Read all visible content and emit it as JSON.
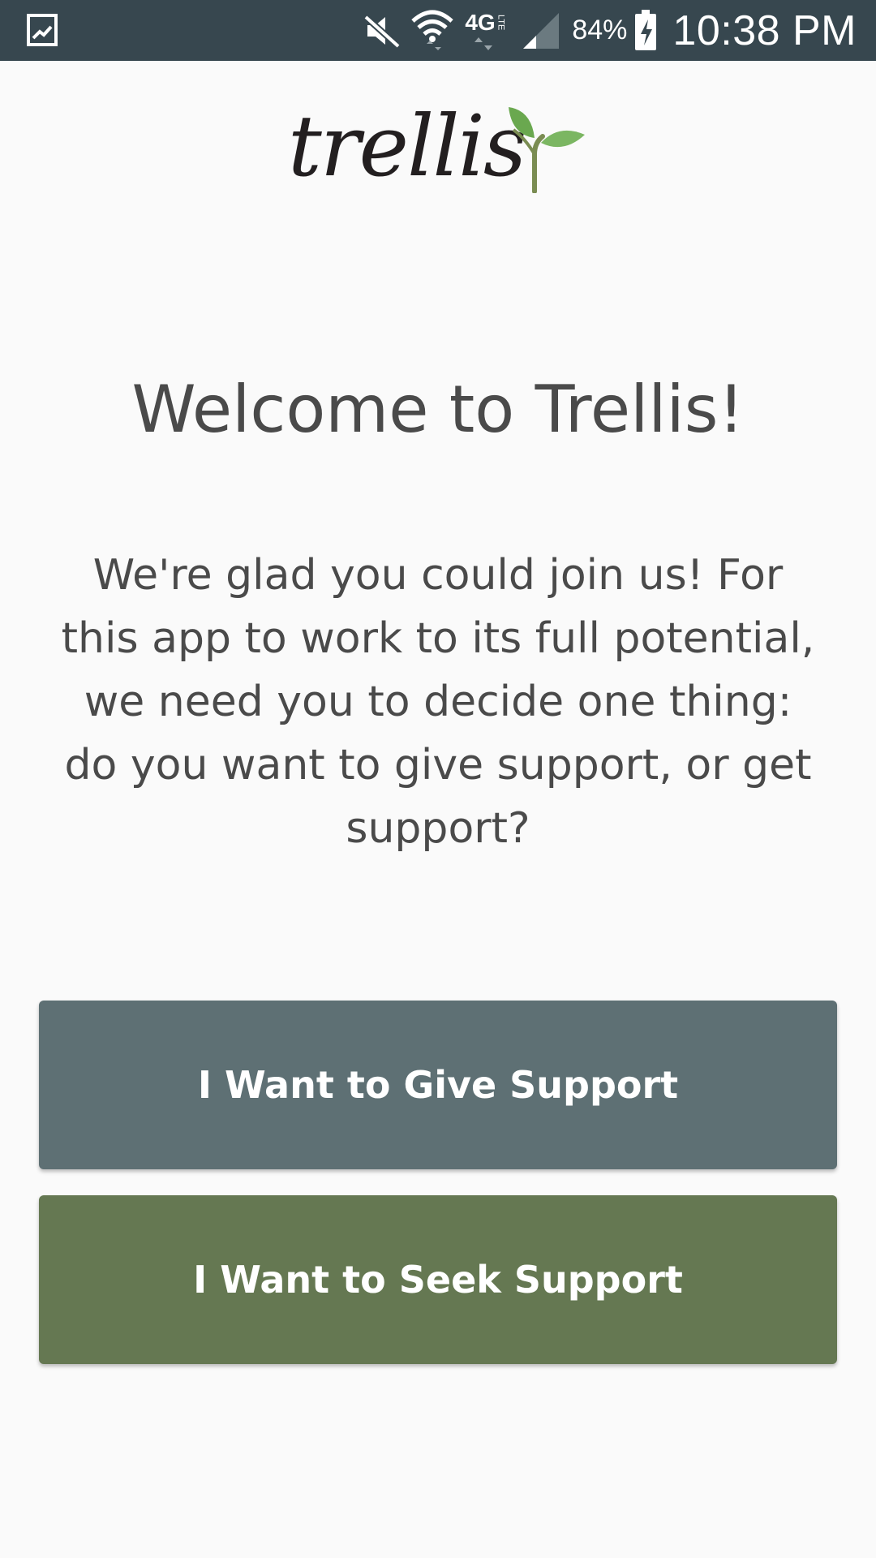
{
  "status_bar": {
    "battery_percent": "84%",
    "time": "10:38 PM",
    "network_label": "4G",
    "network_sub": "LTE",
    "icons": [
      "gallery-notification-icon",
      "mute-icon",
      "wifi-icon",
      "4g-lte-icon",
      "signal-icon",
      "battery-charging-icon"
    ]
  },
  "logo": {
    "text": "trellis",
    "leaf_color": "#6aa84f",
    "stem_color": "#7a8c52"
  },
  "welcome": {
    "title": "Welcome to Trellis!",
    "body": "We're glad you could join us! For this app to work to its full potential, we need you to decide one thing: do you want to give support, or get support?"
  },
  "buttons": {
    "give_label": "I Want to Give Support",
    "seek_label": "I Want to Seek Support",
    "give_color": "#5e7074",
    "seek_color": "#657852"
  }
}
